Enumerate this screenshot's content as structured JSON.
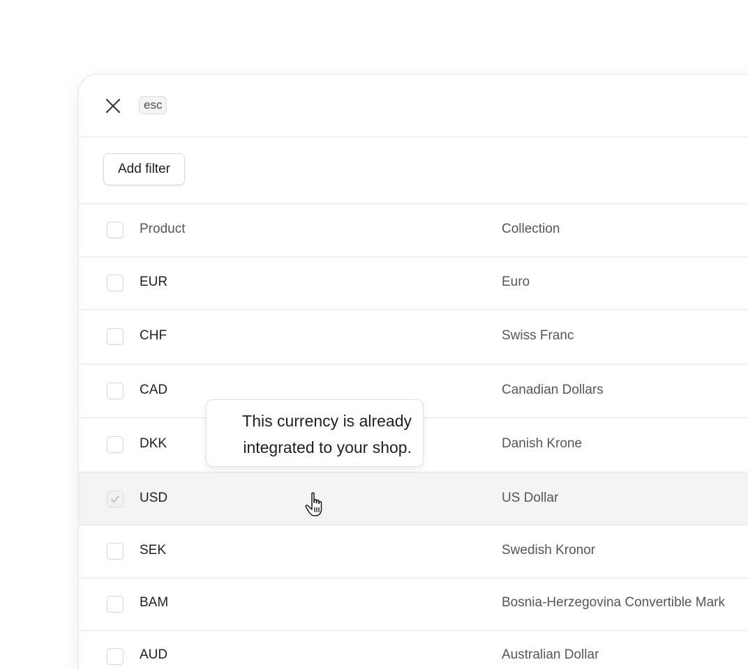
{
  "modal": {
    "esc_label": "esc",
    "add_filter_label": "Add filter"
  },
  "table": {
    "columns": {
      "product": "Product",
      "collection": "Collection"
    },
    "rows": [
      {
        "product": "EUR",
        "collection": "Euro",
        "checked": false,
        "disabled": false
      },
      {
        "product": "CHF",
        "collection": "Swiss Franc",
        "checked": false,
        "disabled": false
      },
      {
        "product": "CAD",
        "collection": "Canadian Dollars",
        "checked": false,
        "disabled": false
      },
      {
        "product": "DKK",
        "collection": "Danish Krone",
        "checked": false,
        "disabled": false
      },
      {
        "product": "USD",
        "collection": "US Dollar",
        "checked": true,
        "disabled": true,
        "hovered": true
      },
      {
        "product": "SEK",
        "collection": "Swedish Kronor",
        "checked": false,
        "disabled": false
      },
      {
        "product": "BAM",
        "collection": "Bosnia-Herzegovina Convertible Mark",
        "checked": false,
        "disabled": false
      },
      {
        "product": "AUD",
        "collection": "Australian Dollar",
        "checked": false,
        "disabled": false
      }
    ]
  },
  "tooltip": {
    "line1": "This currency is already",
    "line2": "integrated to your shop."
  },
  "icons": {
    "close": "close-icon",
    "check": "check-icon",
    "cursor": "pointer-hand-icon"
  },
  "colors": {
    "border": "#e5e5e7",
    "hover_row": "#f4f4f5",
    "text_primary": "#1f1f23",
    "text_secondary": "#55555c"
  }
}
